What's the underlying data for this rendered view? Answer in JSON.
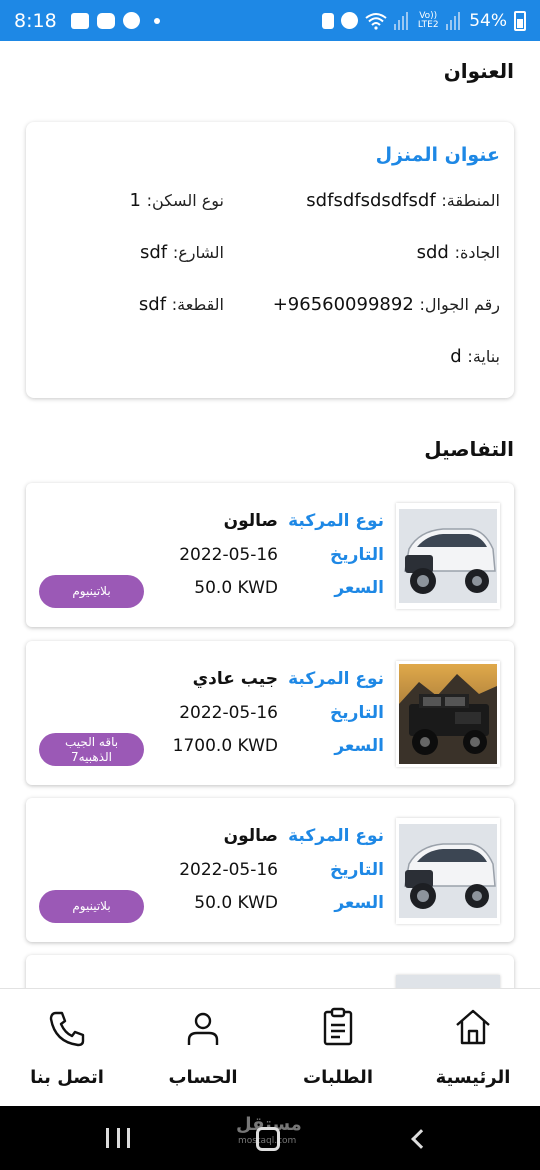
{
  "status_bar": {
    "time": "8:18",
    "battery": "54%",
    "network_small": "Vo)) LTE2",
    "icons": [
      "image-icon",
      "youtube-icon",
      "compass-icon",
      "dot-icon",
      "lock-icon",
      "alarm-icon",
      "wifi-icon",
      "signal-icon"
    ]
  },
  "address_section": {
    "title": "العنوان",
    "card_title": "عنوان المنزل",
    "fields": {
      "area": {
        "label": "المنطقة:",
        "value": "sdfsdfsdsdfsdf"
      },
      "residence_type": {
        "label": "نوع السكن:",
        "value": "1"
      },
      "avenue": {
        "label": "الجادة:",
        "value": "sdd"
      },
      "street": {
        "label": "الشارع:",
        "value": "sdf"
      },
      "mobile": {
        "label": "رقم الجوال:",
        "value": "+96560099892"
      },
      "block": {
        "label": "القطعة:",
        "value": "sdf"
      },
      "building": {
        "label": "بناية:",
        "value": "d"
      }
    }
  },
  "details_section": {
    "title": "التفاصيل",
    "labels": {
      "vehicle_type": "نوع المركبة",
      "date": "التاريخ",
      "price": "السعر"
    },
    "orders": [
      {
        "vehicle": "صالون",
        "date": "2022-05-16",
        "price": "50.0 KWD",
        "package": "بلاتينيوم",
        "image": "white-suv-image"
      },
      {
        "vehicle": "جيب عادي",
        "date": "2022-05-16",
        "price": "1700.0 KWD",
        "package": "باقه الجيب الذهبيه7",
        "image": "black-jeep-image"
      },
      {
        "vehicle": "صالون",
        "date": "2022-05-16",
        "price": "50.0 KWD",
        "package": "بلاتينيوم",
        "image": "white-suv-image"
      }
    ]
  },
  "bottom_nav": {
    "home": "الرئيسية",
    "orders": "الطلبات",
    "account": "الحساب",
    "contact": "اتصل بنا"
  },
  "watermark": {
    "text": "مستقل",
    "sub": "mostaql.com"
  },
  "colors": {
    "accent": "#1e88e5",
    "badge": "#9b59b6",
    "status_bar": "#1e88e5"
  }
}
